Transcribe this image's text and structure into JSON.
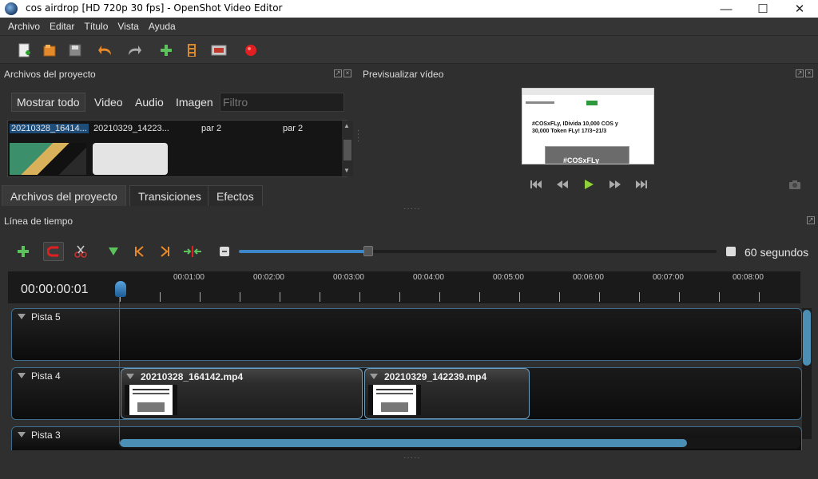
{
  "window": {
    "title": "cos airdrop [HD 720p 30 fps] - OpenShot Video Editor"
  },
  "menu": [
    "Archivo",
    "Editar",
    "Título",
    "Vista",
    "Ayuda"
  ],
  "toolbar_icons": [
    "new-project-icon",
    "open-project-icon",
    "save-project-icon",
    "undo-icon",
    "redo-icon",
    "import-files-icon",
    "choose-profile-icon",
    "fullscreen-icon",
    "export-video-icon"
  ],
  "files_panel": {
    "title": "Archivos del proyecto",
    "filters": [
      "Mostrar todo",
      "Video",
      "Audio",
      "Imagen"
    ],
    "filter_placeholder": "Filtro",
    "columns": [
      "20210328_16414...",
      "20210329_14223...",
      "par 2",
      "par 2"
    ],
    "tabs": [
      "Archivos del proyecto",
      "Transiciones",
      "Efectos"
    ]
  },
  "preview": {
    "title": "Previsualizar vídeo",
    "thumb_lines": [
      "#COSxFLy, IDivida 10,000 COS y",
      "30,000 Token FLy! 17/3~21/3",
      "#COSxFLy"
    ]
  },
  "timeline": {
    "title": "Línea de tiempo",
    "timecode": "00:00:00:01",
    "zoom_label": "60 segundos",
    "zoom_level_pct": 27,
    "ruler": [
      "00:01:00",
      "00:02:00",
      "00:03:00",
      "00:04:00",
      "00:05:00",
      "00:06:00",
      "00:07:00",
      "00:08:00"
    ],
    "tracks": [
      {
        "name": "Pista 5",
        "clips": []
      },
      {
        "name": "Pista 4",
        "clips": [
          "20210328_164142.mp4",
          "20210329_142239.mp4"
        ]
      },
      {
        "name": "Pista 3",
        "clips": []
      }
    ]
  },
  "colors": {
    "accent": "#3b87c7",
    "playhead": "#e02020",
    "record": "#e02020"
  }
}
